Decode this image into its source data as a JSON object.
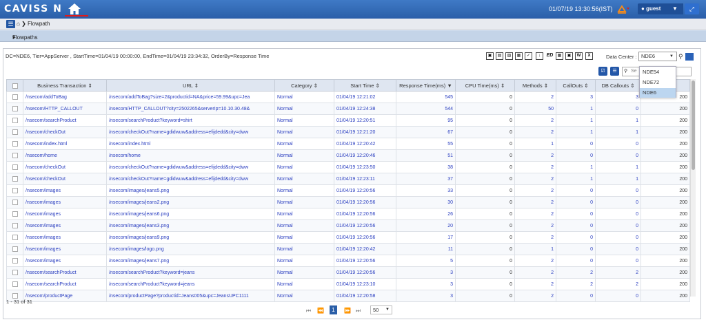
{
  "app": {
    "logo": "CAVISS N"
  },
  "topbar": {
    "datetime": "01/07/19 13:30:56(IST)",
    "user": "guest"
  },
  "breadcrumb": {
    "page": "Flowpath"
  },
  "panel": {
    "title": "Flowpaths"
  },
  "filter_text": "DC=NDE6, Tier=AppServer , StartTime=01/04/19 00:00:00, EndTime=01/04/19 23:34:32, OrderBy=Response Time",
  "data_center": {
    "label": "Data Center :",
    "selected": "NDE6",
    "options": [
      "NDE54",
      "NDE72",
      "NDE6"
    ]
  },
  "search": {
    "placeholder": "Se"
  },
  "table": {
    "columns": [
      "Business Transaction",
      "URL",
      "Category",
      "Start Time",
      "Response Time(ms)",
      "CPU Time(ms)",
      "Methods",
      "CallOuts",
      "DB Callouts",
      ""
    ],
    "rows": [
      [
        "/nsecom/addToBag",
        "/nsecom/addToBag?size=2&productid=NA&price=59.99&upc=Jea",
        "Normal",
        "01/04/19 12:21:02",
        "545",
        "0",
        "2",
        "3",
        "3",
        "200"
      ],
      [
        "/nsecom/HTTP_CALLOUT",
        "/nsecom/HTTP_CALLOUT?city=2502265&serverIp=10.10.30.48&",
        "Normal",
        "01/04/19 12:24:38",
        "544",
        "0",
        "50",
        "1",
        "0",
        "200"
      ],
      [
        "/nsecom/searchProduct",
        "/nsecom/searchProduct?keyword=shirt",
        "Normal",
        "01/04/19 12:20:51",
        "95",
        "0",
        "2",
        "1",
        "1",
        "200"
      ],
      [
        "/nsecom/checkOut",
        "/nsecom/checkOut?name=gdidwuw&address=efijdedd&city=dww",
        "Normal",
        "01/04/19 12:21:20",
        "67",
        "0",
        "2",
        "1",
        "1",
        "200"
      ],
      [
        "/nsecom/index.html",
        "/nsecom/index.html",
        "Normal",
        "01/04/19 12:20:42",
        "55",
        "0",
        "1",
        "0",
        "0",
        "200"
      ],
      [
        "/nsecom/home",
        "/nsecom/home",
        "Normal",
        "01/04/19 12:20:46",
        "51",
        "0",
        "2",
        "0",
        "0",
        "200"
      ],
      [
        "/nsecom/checkOut",
        "/nsecom/checkOut?name=gdidwuw&address=efijdedd&city=dww",
        "Normal",
        "01/04/19 12:23:50",
        "38",
        "0",
        "2",
        "1",
        "1",
        "200"
      ],
      [
        "/nsecom/checkOut",
        "/nsecom/checkOut?name=gdidwuw&address=efijdedd&city=dww",
        "Normal",
        "01/04/19 12:23:11",
        "37",
        "0",
        "2",
        "1",
        "1",
        "200"
      ],
      [
        "/nsecom/images",
        "/nsecom/images/jeans5.png",
        "Normal",
        "01/04/19 12:20:56",
        "33",
        "0",
        "2",
        "0",
        "0",
        "200"
      ],
      [
        "/nsecom/images",
        "/nsecom/images/jeans2.png",
        "Normal",
        "01/04/19 12:20:56",
        "30",
        "0",
        "2",
        "0",
        "0",
        "200"
      ],
      [
        "/nsecom/images",
        "/nsecom/images/jeans6.png",
        "Normal",
        "01/04/19 12:20:56",
        "26",
        "0",
        "2",
        "0",
        "0",
        "200"
      ],
      [
        "/nsecom/images",
        "/nsecom/images/jeans3.png",
        "Normal",
        "01/04/19 12:20:56",
        "20",
        "0",
        "2",
        "0",
        "0",
        "200"
      ],
      [
        "/nsecom/images",
        "/nsecom/images/jeans9.png",
        "Normal",
        "01/04/19 12:20:56",
        "17",
        "0",
        "2",
        "0",
        "0",
        "200"
      ],
      [
        "/nsecom/images",
        "/nsecom/images/logo.png",
        "Normal",
        "01/04/19 12:20:42",
        "11",
        "0",
        "1",
        "0",
        "0",
        "200"
      ],
      [
        "/nsecom/images",
        "/nsecom/images/jeans7.png",
        "Normal",
        "01/04/19 12:20:56",
        "5",
        "0",
        "2",
        "0",
        "0",
        "200"
      ],
      [
        "/nsecom/searchProduct",
        "/nsecom/searchProduct?keyword=jeans",
        "Normal",
        "01/04/19 12:20:56",
        "3",
        "0",
        "2",
        "2",
        "2",
        "200"
      ],
      [
        "/nsecom/searchProduct",
        "/nsecom/searchProduct?keyword=jeans",
        "Normal",
        "01/04/19 12:23:10",
        "3",
        "0",
        "2",
        "2",
        "2",
        "200"
      ],
      [
        "/nsecom/productPage",
        "/nsecom/productPage?productid=Jeans005&upc=JeansUPC1111",
        "Normal",
        "01/04/19 12:20:58",
        "3",
        "0",
        "2",
        "0",
        "0",
        "200"
      ]
    ]
  },
  "pagination": {
    "info": "1 - 31 of 31",
    "current": "1",
    "per_page": "50"
  },
  "colors": {
    "topbar": "#2f67b4",
    "panel_header": "#c4d4e8",
    "link": "#2a3ec0",
    "accent": "#2b5fa8"
  }
}
